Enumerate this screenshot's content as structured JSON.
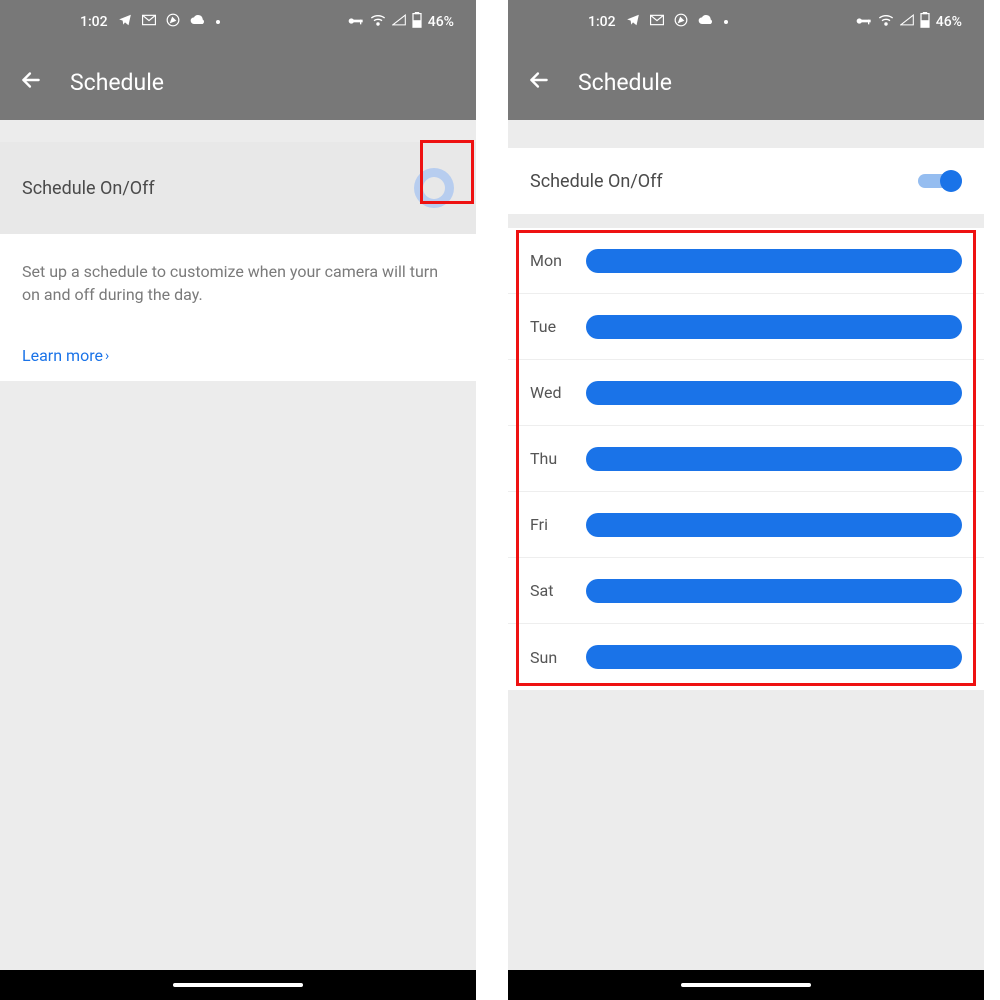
{
  "status": {
    "time": "1:02",
    "battery": "46%"
  },
  "appbar": {
    "title": "Schedule"
  },
  "left": {
    "toggle_label": "Schedule On/Off",
    "description": "Set up a schedule to customize when your camera will turn on and off during the day.",
    "learn_more": "Learn more"
  },
  "right": {
    "toggle_label": "Schedule On/Off",
    "days": [
      "Mon",
      "Tue",
      "Wed",
      "Thu",
      "Fri",
      "Sat",
      "Sun"
    ]
  },
  "colors": {
    "accent": "#1a73e8",
    "highlight": "#e11"
  }
}
